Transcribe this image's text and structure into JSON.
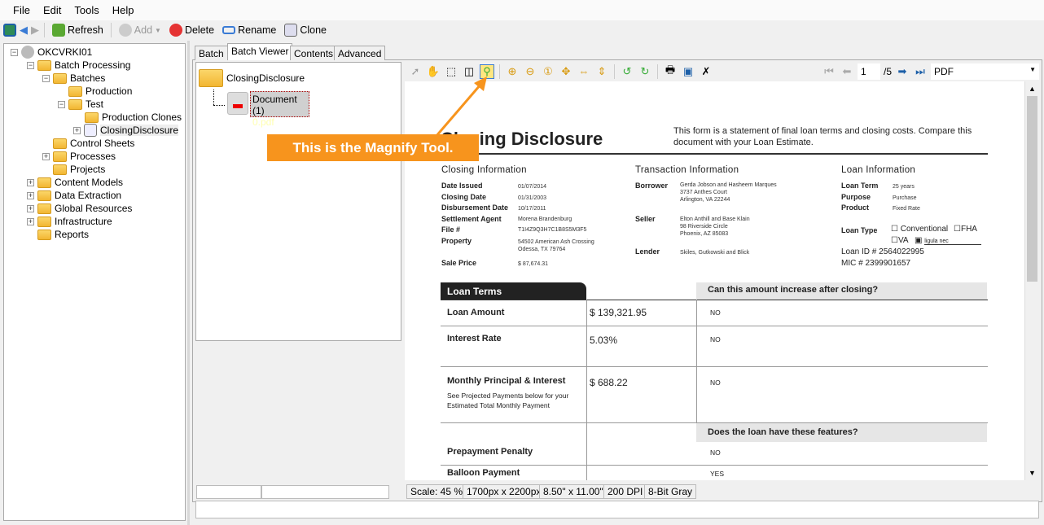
{
  "menu": [
    "File",
    "Edit",
    "Tools",
    "Help"
  ],
  "toolbar": {
    "refresh": "Refresh",
    "add": "Add",
    "delete": "Delete",
    "rename": "Rename",
    "clone": "Clone"
  },
  "tree": {
    "root": "OKCVRKI01",
    "batch_processing": "Batch Processing",
    "batches": "Batches",
    "production": "Production",
    "test": "Test",
    "production_clones": "Production Clones",
    "closing_disclosure": "ClosingDisclosure",
    "control_sheets": "Control Sheets",
    "processes": "Processes",
    "projects": "Projects",
    "content_models": "Content Models",
    "data_extraction": "Data Extraction",
    "global_resources": "Global Resources",
    "infrastructure": "Infrastructure",
    "reports": "Reports"
  },
  "tabs": [
    "Batch",
    "Batch Viewer",
    "Contents",
    "Advanced"
  ],
  "batch_tree": {
    "folder": "ClosingDisclosure",
    "document": "Document (1)",
    "file": "0.pdf"
  },
  "viewer": {
    "page": "1",
    "page_total": "/5",
    "format": "PDF"
  },
  "document": {
    "title": "Closing Disclosure",
    "intro": "This form is a statement of final loan terms and closing costs. Compare this document with your Loan Estimate.",
    "closing_info": {
      "heading": "Closing  Information",
      "rows": [
        [
          "Date Issued",
          "01/07/2014"
        ],
        [
          "Closing Date",
          "01/31/2003"
        ],
        [
          "Disbursement Date",
          "10/17/2011"
        ],
        [
          "Settlement Agent",
          "Morena Brandenburg"
        ],
        [
          "File #",
          "T1I4Z9Q3H7C1B8S5M3F5"
        ],
        [
          "Property",
          "54502 American Ash Crossing\nOdessa, TX 79764"
        ],
        [
          "Sale Price",
          "$ 87,674.31"
        ]
      ]
    },
    "transaction_info": {
      "heading": "Transaction  Information",
      "borrower_label": "Borrower",
      "borrower": [
        "Gerda Jobson and Hasheem Marques",
        "3737 Anthes Court",
        "Arlington, VA 22244"
      ],
      "seller_label": "Seller",
      "seller": [
        "Elton Anthill and Base Klain",
        "98 Riverside Circle",
        "Phoenix, AZ 85083"
      ],
      "lender_label": "Lender",
      "lender": "Skiles, Gutkowski and Blick"
    },
    "loan_info": {
      "heading": "Loan  Information",
      "term_label": "Loan Term",
      "term": "25 years",
      "purpose_label": "Purpose",
      "purpose": "Purchase",
      "product_label": "Product",
      "product": "Fixed Rate",
      "type_label": "Loan Type",
      "types": [
        "Conventional",
        "FHA",
        "VA",
        "ligula nec"
      ],
      "loan_id": "Loan ID # 2564022995",
      "mic": "MIC # 2399901657"
    },
    "loan_terms": {
      "heading": "Loan Terms",
      "question1": "Can this amount increase after closing?",
      "question2": "Does the loan have these features?",
      "rows": [
        {
          "label": "Loan Amount",
          "value": "$ 139,321.95",
          "answer": "NO"
        },
        {
          "label": "Interest Rate",
          "value": "5.03%",
          "answer": "NO"
        },
        {
          "label": "Monthly Principal & Interest",
          "sub": "See Projected Payments below for your\nEstimated Total Monthly Payment",
          "value": "$ 688.22",
          "answer": "NO"
        },
        {
          "label": "Prepayment Penalty",
          "answer": "NO"
        },
        {
          "label": "Balloon Payment",
          "answer": "YES"
        }
      ]
    }
  },
  "status": {
    "scale": "Scale: 45 %",
    "pixels": "1700px x 2200px",
    "size": "8.50\" x 11.00\"",
    "dpi": "200 DPI",
    "depth": "8-Bit Gray"
  },
  "callout": "This is the Magnify Tool.",
  "colors": {
    "callout": "#f7941d",
    "highlight": "#ffe680"
  }
}
